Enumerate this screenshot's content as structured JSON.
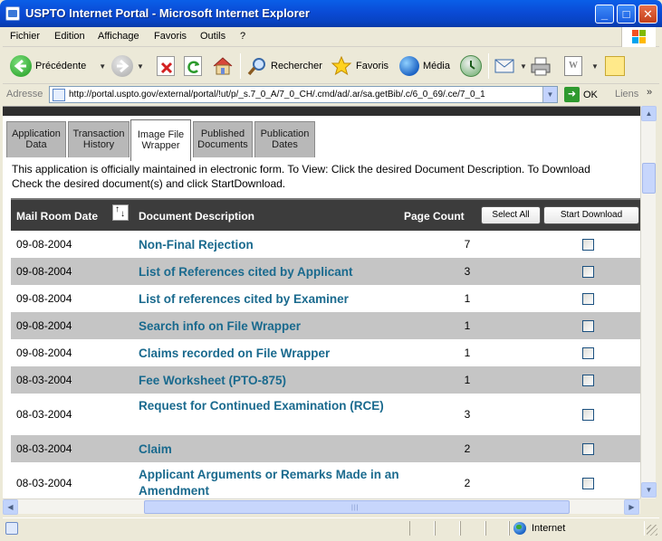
{
  "window": {
    "title": "USPTO Internet Portal - Microsoft Internet Explorer"
  },
  "menu": [
    "Fichier",
    "Edition",
    "Affichage",
    "Favoris",
    "Outils",
    "?"
  ],
  "toolbar": {
    "back_label": "Précédente",
    "search_label": "Rechercher",
    "favorites_label": "Favoris",
    "media_label": "Média"
  },
  "address": {
    "label": "Adresse",
    "url": "http://portal.uspto.gov/external/portal/!ut/p/_s.7_0_A/7_0_CH/.cmd/ad/.ar/sa.getBib/.c/6_0_69/.ce/7_0_1",
    "go_label": "OK",
    "links_label": "Liens"
  },
  "tabs": [
    {
      "line1": "Application",
      "line2": "Data"
    },
    {
      "line1": "Transaction",
      "line2": "History"
    },
    {
      "line1": "Image File",
      "line2": "Wrapper"
    },
    {
      "line1": "Published",
      "line2": "Documents"
    },
    {
      "line1": "Publication",
      "line2": "Dates"
    }
  ],
  "intro": {
    "line1": "This application is officially maintained in electronic form. To View: Click the desired Document Description. To Download",
    "line2": "Check the desired document(s) and click StartDownload."
  },
  "table": {
    "headers": {
      "date": "Mail Room Date",
      "description": "Document Description",
      "pages": "Page Count",
      "select_all": "Select All",
      "start_download": "Start Download"
    },
    "rows": [
      {
        "date": "09-08-2004",
        "description": "Non-Final Rejection",
        "pages": "7"
      },
      {
        "date": "09-08-2004",
        "description": "List of References cited by Applicant",
        "pages": "3"
      },
      {
        "date": "09-08-2004",
        "description": "List of references cited by Examiner",
        "pages": "1"
      },
      {
        "date": "09-08-2004",
        "description": "Search info on File Wrapper",
        "pages": "1"
      },
      {
        "date": "09-08-2004",
        "description": "Claims recorded on File Wrapper",
        "pages": "1"
      },
      {
        "date": "08-03-2004",
        "description": "Fee Worksheet (PTO-875)",
        "pages": "1"
      },
      {
        "date": "08-03-2004",
        "description": "Request for Continued Examination (RCE)",
        "pages": "3"
      },
      {
        "date": "08-03-2004",
        "description": "Claim",
        "pages": "2"
      },
      {
        "date": "08-03-2004",
        "description": "Applicant Arguments or Remarks Made in an Amendment",
        "pages": "2"
      }
    ]
  },
  "status": {
    "zone": "Internet"
  },
  "colors": {
    "title_bar": "#0a4bd6",
    "link_text": "#1a6a8e",
    "table_header": "#3c3c3c",
    "row_shade": "#c5c5c5"
  },
  "icons": [
    "ie-page-icon",
    "back-arrow-icon",
    "forward-arrow-icon",
    "stop-icon",
    "refresh-icon",
    "home-icon",
    "search-icon",
    "favorites-star-icon",
    "media-icon",
    "history-icon",
    "mail-icon",
    "print-icon",
    "edit-icon",
    "notes-icon",
    "go-arrow-icon",
    "sort-icon",
    "globe-icon",
    "windows-flag-icon"
  ]
}
